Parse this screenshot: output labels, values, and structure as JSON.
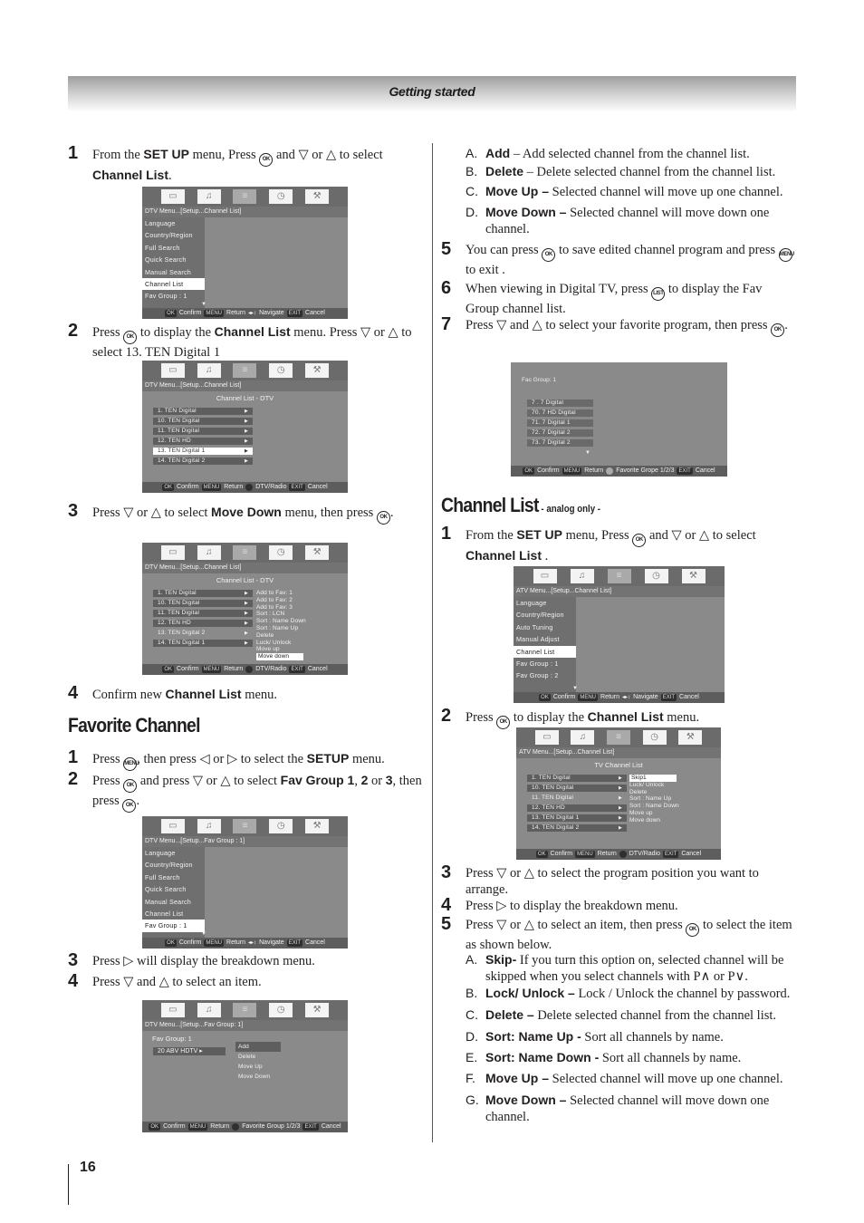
{
  "header": {
    "section": "Getting started"
  },
  "page_number": "16",
  "icons_strip": [
    "tv-picture-icon",
    "music-note-icon",
    "settings-sliders-icon",
    "clock-icon",
    "wrench-icon"
  ],
  "left": {
    "dtv_steps": [
      {
        "n": "1",
        "parts": [
          {
            "t": "From the "
          },
          {
            "b": "SET UP"
          },
          {
            "t": " menu, Press "
          },
          {
            "btn": "OK"
          },
          {
            "t": " and ▽ or △ to select "
          },
          {
            "b": "Channel List"
          },
          {
            "t": "."
          }
        ]
      },
      {
        "n": "2",
        "parts": [
          {
            "t": "Press "
          },
          {
            "btn": "OK"
          },
          {
            "t": " to display the "
          },
          {
            "b": "Channel List"
          },
          {
            "t": " menu. Press ▽ or △ to select 13. TEN Digital 1"
          }
        ]
      },
      {
        "n": "3",
        "parts": [
          {
            "t": "Press ▽ or △ to select "
          },
          {
            "b": "Move Down"
          },
          {
            "t": " menu, then press "
          },
          {
            "btn": "OK"
          },
          {
            "t": "."
          }
        ]
      },
      {
        "n": "4",
        "parts": [
          {
            "t": "Confirm new "
          },
          {
            "b": "Channel List"
          },
          {
            "t": " menu."
          }
        ]
      }
    ],
    "fav_heading": "Favorite Channel",
    "fav_steps": [
      {
        "n": "1",
        "parts": [
          {
            "t": "Press "
          },
          {
            "btn": "MENU"
          },
          {
            "t": ", then press ◁ or ▷ to select the "
          },
          {
            "b": "SETUP"
          },
          {
            "t": " menu."
          }
        ]
      },
      {
        "n": "2",
        "parts": [
          {
            "t": "Press "
          },
          {
            "btn": "OK"
          },
          {
            "t": " and press ▽ or △ to select "
          },
          {
            "b": "Fav Group 1"
          },
          {
            "t": ", "
          },
          {
            "b": "2"
          },
          {
            "t": " or "
          },
          {
            "b": "3"
          },
          {
            "t": ", then press "
          },
          {
            "btn": "OK"
          },
          {
            "t": "."
          }
        ]
      },
      {
        "n": "3",
        "parts": [
          {
            "t": "Press ▷ will display the breakdown menu."
          }
        ]
      },
      {
        "n": "4",
        "parts": [
          {
            "t": "Press ▽ and △ to select an item."
          }
        ]
      }
    ]
  },
  "right": {
    "fav_items": [
      {
        "l": "A.",
        "b": "Add",
        "t": " – Add selected channel from the channel list."
      },
      {
        "l": "B.",
        "b": "Delete",
        "t": " – Delete selected channel from the channel list."
      },
      {
        "l": "C.",
        "b": "Move Up –",
        "t": " Selected channel will move up one channel."
      },
      {
        "l": "D.",
        "b": "Move Down –",
        "t": " Selected channel will move down one channel."
      }
    ],
    "fav_steps": [
      {
        "n": "5",
        "parts": [
          {
            "t": "You can press "
          },
          {
            "btn": "OK"
          },
          {
            "t": "  to save edited channel program and press "
          },
          {
            "btn": "MENU"
          },
          {
            "t": " to exit ."
          }
        ]
      },
      {
        "n": "6",
        "parts": [
          {
            "t": "When viewing in Digital TV, press "
          },
          {
            "btn": "LIST"
          },
          {
            "t": " to display the Fav Group channel list."
          }
        ]
      },
      {
        "n": "7",
        "parts": [
          {
            "t": "Press ▽ and △ to select your favorite program, then press "
          },
          {
            "btn": "OK"
          },
          {
            "t": "."
          }
        ]
      }
    ],
    "cl_heading": "Channel List",
    "cl_heading_note": " - analog only -",
    "cl_steps": [
      {
        "n": "1",
        "parts": [
          {
            "t": "From the "
          },
          {
            "b": "SET UP"
          },
          {
            "t": " menu, Press "
          },
          {
            "btn": "OK"
          },
          {
            "t": " and ▽ or △ to select "
          },
          {
            "b": "Channel List"
          },
          {
            "t": " ."
          }
        ]
      },
      {
        "n": "2",
        "parts": [
          {
            "t": "Press "
          },
          {
            "btn": "OK"
          },
          {
            "t": " to display the "
          },
          {
            "b": "Channel List"
          },
          {
            "t": " menu."
          }
        ]
      },
      {
        "n": "3",
        "parts": [
          {
            "t": "Press ▽ or △  to select the program position you want to arrange."
          }
        ]
      },
      {
        "n": "4",
        "parts": [
          {
            "t": "Press ▷ to display the breakdown menu."
          }
        ]
      },
      {
        "n": "5",
        "parts": [
          {
            "t": "Press ▽ or △  to select an item, then press "
          },
          {
            "btn": "OK"
          },
          {
            "t": " to select the item as shown below."
          }
        ]
      }
    ],
    "cl_items": [
      {
        "l": "A.",
        "b": "Skip-",
        "t": " If you turn this option on, selected channel will be skipped when you select channels with P∧ or P∨."
      },
      {
        "l": "B.",
        "b": "Lock/ Unlock –",
        "t": " Lock / Unlock the channel by password."
      },
      {
        "l": "C.",
        "b": "Delete –",
        "t": " Delete selected channel from the channel list."
      },
      {
        "l": "D.",
        "b": "Sort: Name Up -",
        "t": " Sort all channels by name."
      },
      {
        "l": "E.",
        "b": "Sort: Name Down -",
        "t": " Sort all channels by name."
      },
      {
        "l": "F.",
        "b": "Move Up –",
        "t": " Selected channel will move up one channel."
      },
      {
        "l": "G.",
        "b": "Move Down –",
        "t": " Selected channel will move down one channel."
      }
    ]
  },
  "screens": {
    "s1": {
      "crumb": "DTV Menu...[Setup...Channel List]",
      "side": [
        "Language",
        "Country/Region",
        "Full Search",
        "Quick Search",
        "Manual Search",
        "Channel List",
        "Fav Group : 1"
      ],
      "selected": 5,
      "footer": [
        [
          "OK",
          "Confirm"
        ],
        [
          "MENU",
          "Return"
        ],
        [
          "◂▸↕",
          "Navigate"
        ],
        [
          "EXIT",
          "Cancel"
        ]
      ]
    },
    "s2": {
      "crumb": "DTV Menu...[Setup...Channel List]",
      "title": "Channel List - DTV",
      "list": [
        "1. TEN Digital",
        "10. TEN Digital",
        "11. TEN Digital",
        "12. TEN HD",
        "13. TEN Digital  1",
        "14. TEN Digital  2"
      ],
      "selected": 4,
      "footer": [
        [
          "OK",
          "Confirm"
        ],
        [
          "MENU",
          "Return"
        ],
        [
          "●",
          "DTV/Radio"
        ],
        [
          "EXIT",
          "Cancel"
        ]
      ]
    },
    "s3": {
      "crumb": "DTV Menu...[Setup...Channel List]",
      "title": "Channel List - DTV",
      "list": [
        "1. TEN Digital",
        "10. TEN Digital",
        "11. TEN Digital",
        "12. TEN HD",
        "13. TEN Digital  2",
        "14. TEN Digital  1"
      ],
      "plain": 4,
      "breakdown": [
        "Add to Fav: 1",
        "Add to Fav: 2",
        "Add to Fav: 3",
        "Sort : LCN",
        "Sort : Name Down",
        "Sort : Name Up",
        "Delete",
        "Luck/ Unlock",
        "Move up",
        "Move down"
      ],
      "bd_selected": 9,
      "footer": [
        [
          "OK",
          "Confirm"
        ],
        [
          "MENU",
          "Return"
        ],
        [
          "●",
          "DTV/Radio"
        ],
        [
          "EXIT",
          "Cancel"
        ]
      ]
    },
    "s4": {
      "crumb": "DTV Menu...[Setup...Fav Group : 1]",
      "side": [
        "Language",
        "Country/Region",
        "Full Search",
        "Quick Search",
        "Manual Search",
        "Channel List",
        "Fav Group : 1"
      ],
      "selected": 6,
      "footer": [
        [
          "OK",
          "Confirm"
        ],
        [
          "MENU",
          "Return"
        ],
        [
          "◂▸↕",
          "Navigate"
        ],
        [
          "EXIT",
          "Cancel"
        ]
      ]
    },
    "s5": {
      "crumb": "DTV Menu...[Setup...Fav Group: 1]",
      "group": "Fav Group:  1",
      "channel": "20  ABV  HDTV",
      "breakdown": [
        "Add",
        "Delete",
        "Move Up",
        "Move Down"
      ],
      "footer": [
        [
          "OK",
          "Confirm"
        ],
        [
          "MENU",
          "Return"
        ],
        [
          "●",
          "Favorite Group 1/2/3"
        ],
        [
          "EXIT",
          "Cancel"
        ]
      ]
    },
    "s6": {
      "group": "Fac Group:    1",
      "list": [
        "7 . 7 Digital",
        "70. 7 HD Digital",
        "71. 7 Digital 1",
        "72. 7 Digital 2",
        "73. 7 Digital 2"
      ],
      "footer": [
        [
          "OK",
          "Confirm"
        ],
        [
          "MENU",
          "Return"
        ],
        [
          "●",
          "Favorite Grope 1/2/3"
        ],
        [
          "EXIT",
          "Cancel"
        ]
      ]
    },
    "s7": {
      "crumb": "ATV Menu...[Setup...Channel List]",
      "side": [
        "Language",
        "Country/Region",
        "Auto Tuning",
        "Manual Adjust",
        "Channel List",
        "Fav Group : 1",
        "Fav Group : 2"
      ],
      "selected": 4,
      "footer": [
        [
          "OK",
          "Confirm"
        ],
        [
          "MENU",
          "Return"
        ],
        [
          "◂▸↕",
          "Navigate"
        ],
        [
          "EXIT",
          "Cancel"
        ]
      ]
    },
    "s8": {
      "crumb": "ATV Menu...[Setup...Channel List]",
      "title": "TV Channel List",
      "list": [
        "1. TEN Digital",
        "10. TEN Digital",
        "11. TEN Digital",
        "12. TEN HD",
        "13. TEN Digital  1",
        "14. TEN Digital  2"
      ],
      "plain": 2,
      "breakdown": [
        "Skip1",
        "Luck/ Unlock",
        "Delete",
        "Sort : Name Up",
        "Sort : Name Down",
        "Move up",
        "Move down"
      ],
      "bd_selected": 0,
      "footer": [
        [
          "OK",
          "Confirm"
        ],
        [
          "MENU",
          "Return"
        ],
        [
          "●",
          "DTV/Radio"
        ],
        [
          "EXIT",
          "Cancel"
        ]
      ]
    }
  }
}
